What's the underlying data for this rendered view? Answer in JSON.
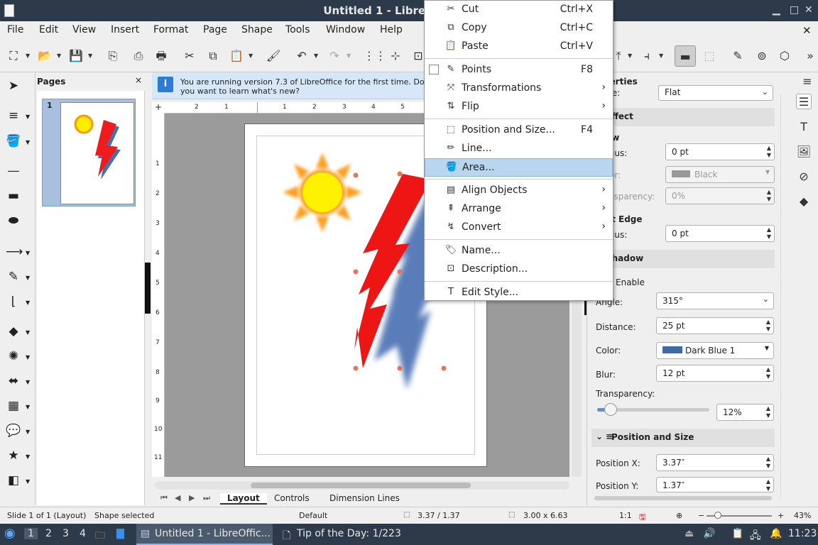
{
  "window": {
    "title": "Untitled 1 - LibreOffice Draw"
  },
  "menubar": [
    "File",
    "Edit",
    "View",
    "Insert",
    "Format",
    "Page",
    "Shape",
    "Tools",
    "Window",
    "Help"
  ],
  "pages_panel": {
    "title": "Pages",
    "page_number": "1"
  },
  "infobar": {
    "text": "You are running version 7.3 of LibreOffice for the first time. Do you want to learn what's new?"
  },
  "ruler_h": [
    "2",
    "1",
    "1",
    "2",
    "3",
    "4",
    "5"
  ],
  "ruler_v": [
    "1",
    "2",
    "3",
    "4",
    "5",
    "6",
    "7",
    "8",
    "9",
    "10",
    "11"
  ],
  "tabs": [
    "Layout",
    "Controls",
    "Dimension Lines"
  ],
  "context_menu": {
    "items": [
      {
        "label": "Cut",
        "shortcut": "Ctrl+X",
        "icon": "cut-icon"
      },
      {
        "label": "Copy",
        "shortcut": "Ctrl+C",
        "icon": "copy-icon"
      },
      {
        "label": "Paste",
        "shortcut": "Ctrl+V",
        "icon": "paste-icon"
      },
      {
        "label": "Points",
        "shortcut": "F8",
        "icon": "checkbox-icon"
      },
      {
        "label": "Transformations",
        "submenu": true,
        "icon": "transform-icon"
      },
      {
        "label": "Flip",
        "submenu": true,
        "icon": "flip-icon"
      },
      {
        "label": "Position and Size...",
        "shortcut": "F4",
        "icon": "position-size-icon"
      },
      {
        "label": "Line...",
        "icon": "line-icon"
      },
      {
        "label": "Area...",
        "icon": "area-icon",
        "highlighted": true
      },
      {
        "label": "Align Objects",
        "submenu": true,
        "icon": "align-icon"
      },
      {
        "label": "Arrange",
        "submenu": true,
        "icon": "arrange-icon"
      },
      {
        "label": "Convert",
        "submenu": true,
        "icon": "convert-icon"
      },
      {
        "label": "Name...",
        "icon": "name-icon"
      },
      {
        "label": "Description...",
        "icon": "description-icon"
      },
      {
        "label": "Edit Style...",
        "icon": "edit-style-icon"
      }
    ]
  },
  "properties": {
    "title": "Properties",
    "style_label": "Style:",
    "style_value": "Flat",
    "effect_header": "Effect",
    "glow_label": "Glow",
    "glow_radius_label": "Radius:",
    "glow_radius": "0 pt",
    "glow_color_label": "Color:",
    "glow_color": "Black",
    "glow_transparency_label": "Transparency:",
    "glow_transparency": "0%",
    "soft_edge_label": "Soft Edge",
    "soft_radius_label": "Radius:",
    "soft_radius": "0 pt",
    "shadow_header": "Shadow",
    "enable_label": "Enable",
    "angle_label": "Angle:",
    "angle": "315°",
    "distance_label": "Distance:",
    "distance": "25 pt",
    "color_label": "Color:",
    "color": "Dark Blue 1",
    "color_swatch": "#3f6aa8",
    "blur_label": "Blur:",
    "blur": "12 pt",
    "transparency_label": "Transparency:",
    "transparency": "12%",
    "transparency_fraction": 0.12,
    "possize_header": "Position and Size",
    "posx_label": "Position X:",
    "posx": "3.37″",
    "posy_label": "Position Y:",
    "posy": "1.37″"
  },
  "status": {
    "slide": "Slide 1 of 1 (Layout)",
    "shape": "Shape selected",
    "layout": "Default",
    "position": "3.37 / 1.37",
    "size": "3.00 x 6.63",
    "ratio": "1:1",
    "zoom": "43%"
  },
  "taskbar": {
    "workspaces": [
      "1",
      "2",
      "3",
      "4"
    ],
    "app1": "Untitled 1 - LibreOffic...",
    "app2": "Tip of the Day: 1/223",
    "clock": "11:23"
  }
}
